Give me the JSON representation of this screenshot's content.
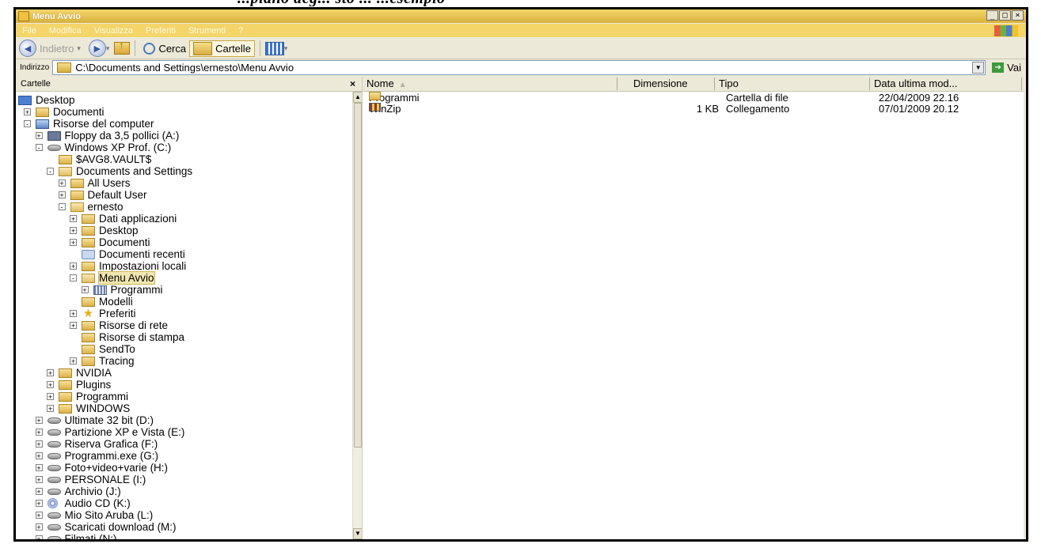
{
  "caption_fragment": "...piano deg... sto ... ...esempio",
  "window": {
    "title": "Menu Avvio",
    "controls": [
      "_",
      "□",
      "×"
    ]
  },
  "menubar": [
    "File",
    "Modifica",
    "Visualizza",
    "Preferiti",
    "Strumenti",
    "?"
  ],
  "toolbar": {
    "back_label": "Indietro",
    "search_label": "Cerca",
    "folders_label": "Cartelle"
  },
  "address": {
    "label": "Indirizzo",
    "path": "C:\\Documents and Settings\\ernesto\\Menu Avvio",
    "go_label": "Vai"
  },
  "folders_pane": {
    "title": "Cartelle",
    "close": "×"
  },
  "tree": [
    {
      "label": "Desktop",
      "icon": "desktop-icon",
      "level": 0,
      "exp": ""
    },
    {
      "label": "Documenti",
      "icon": "documents-icon",
      "level": 1,
      "exp": "+"
    },
    {
      "label": "Risorse del computer",
      "icon": "computer-icon",
      "level": 1,
      "exp": "-"
    },
    {
      "label": "Floppy da 3,5 pollici (A:)",
      "icon": "floppy-icon",
      "level": 2,
      "exp": "+"
    },
    {
      "label": "Windows XP Prof. (C:)",
      "icon": "drive-icon",
      "level": 2,
      "exp": "-"
    },
    {
      "label": "$AVG8.VAULT$",
      "icon": "folder-icon",
      "level": 3,
      "exp": ""
    },
    {
      "label": "Documents and Settings",
      "icon": "folder-open-icon",
      "level": 3,
      "exp": "-"
    },
    {
      "label": "All Users",
      "icon": "folder-icon",
      "level": 4,
      "exp": "+"
    },
    {
      "label": "Default User",
      "icon": "folder-icon",
      "level": 4,
      "exp": "+"
    },
    {
      "label": "ernesto",
      "icon": "folder-open-icon",
      "level": 4,
      "exp": "-"
    },
    {
      "label": "Dati applicazioni",
      "icon": "folder-icon",
      "level": 5,
      "exp": "+"
    },
    {
      "label": "Desktop",
      "icon": "folder-icon",
      "level": 5,
      "exp": "+"
    },
    {
      "label": "Documenti",
      "icon": "folder-icon",
      "level": 5,
      "exp": "+"
    },
    {
      "label": "Documenti recenti",
      "icon": "recent-icon",
      "level": 5,
      "exp": ""
    },
    {
      "label": "Impostazioni locali",
      "icon": "folder-icon",
      "level": 5,
      "exp": "+"
    },
    {
      "label": "Menu Avvio",
      "icon": "folder-open-icon",
      "level": 5,
      "exp": "-",
      "selected": true
    },
    {
      "label": "Programmi",
      "icon": "programs-icon",
      "level": 6,
      "exp": "+"
    },
    {
      "label": "Modelli",
      "icon": "folder-icon",
      "level": 5,
      "exp": ""
    },
    {
      "label": "Preferiti",
      "icon": "star-icon",
      "level": 5,
      "exp": "+"
    },
    {
      "label": "Risorse di rete",
      "icon": "folder-icon",
      "level": 5,
      "exp": "+"
    },
    {
      "label": "Risorse di stampa",
      "icon": "folder-icon",
      "level": 5,
      "exp": ""
    },
    {
      "label": "SendTo",
      "icon": "folder-icon",
      "level": 5,
      "exp": ""
    },
    {
      "label": "Tracing",
      "icon": "folder-icon",
      "level": 5,
      "exp": "+"
    },
    {
      "label": "NVIDIA",
      "icon": "folder-icon",
      "level": 3,
      "exp": "+"
    },
    {
      "label": "Plugins",
      "icon": "folder-icon",
      "level": 3,
      "exp": "+"
    },
    {
      "label": "Programmi",
      "icon": "folder-icon",
      "level": 3,
      "exp": "+"
    },
    {
      "label": "WINDOWS",
      "icon": "folder-icon",
      "level": 3,
      "exp": "+"
    },
    {
      "label": "Ultimate 32 bit (D:)",
      "icon": "drive-icon",
      "level": 2,
      "exp": "+"
    },
    {
      "label": "Partizione XP e Vista (E:)",
      "icon": "drive-icon",
      "level": 2,
      "exp": "+"
    },
    {
      "label": "Riserva Grafica (F:)",
      "icon": "drive-icon",
      "level": 2,
      "exp": "+"
    },
    {
      "label": "Programmi.exe (G:)",
      "icon": "drive-icon",
      "level": 2,
      "exp": "+"
    },
    {
      "label": "Foto+video+varie (H:)",
      "icon": "drive-icon",
      "level": 2,
      "exp": "+"
    },
    {
      "label": "PERSONALE (I:)",
      "icon": "drive-icon",
      "level": 2,
      "exp": "+"
    },
    {
      "label": "Archivio (J:)",
      "icon": "drive-icon",
      "level": 2,
      "exp": "+"
    },
    {
      "label": "Audio CD (K:)",
      "icon": "cd-icon",
      "level": 2,
      "exp": "+"
    },
    {
      "label": "Mio Sito  Aruba (L:)",
      "icon": "drive-icon",
      "level": 2,
      "exp": "+"
    },
    {
      "label": "Scaricati download (M:)",
      "icon": "drive-icon",
      "level": 2,
      "exp": "+"
    },
    {
      "label": "Filmati (N:)",
      "icon": "drive-icon",
      "level": 2,
      "exp": "+"
    }
  ],
  "columns": [
    "Nome",
    "Dimensione",
    "Tipo",
    "Data ultima mod..."
  ],
  "files": [
    {
      "name": "Programmi",
      "icon": "folder-icon",
      "size": "",
      "type": "Cartella di file",
      "date": "22/04/2009 22.16"
    },
    {
      "name": "WinZip",
      "icon": "winzip-icon",
      "size": "1 KB",
      "type": "Collegamento",
      "date": "07/01/2009 20.12"
    }
  ]
}
